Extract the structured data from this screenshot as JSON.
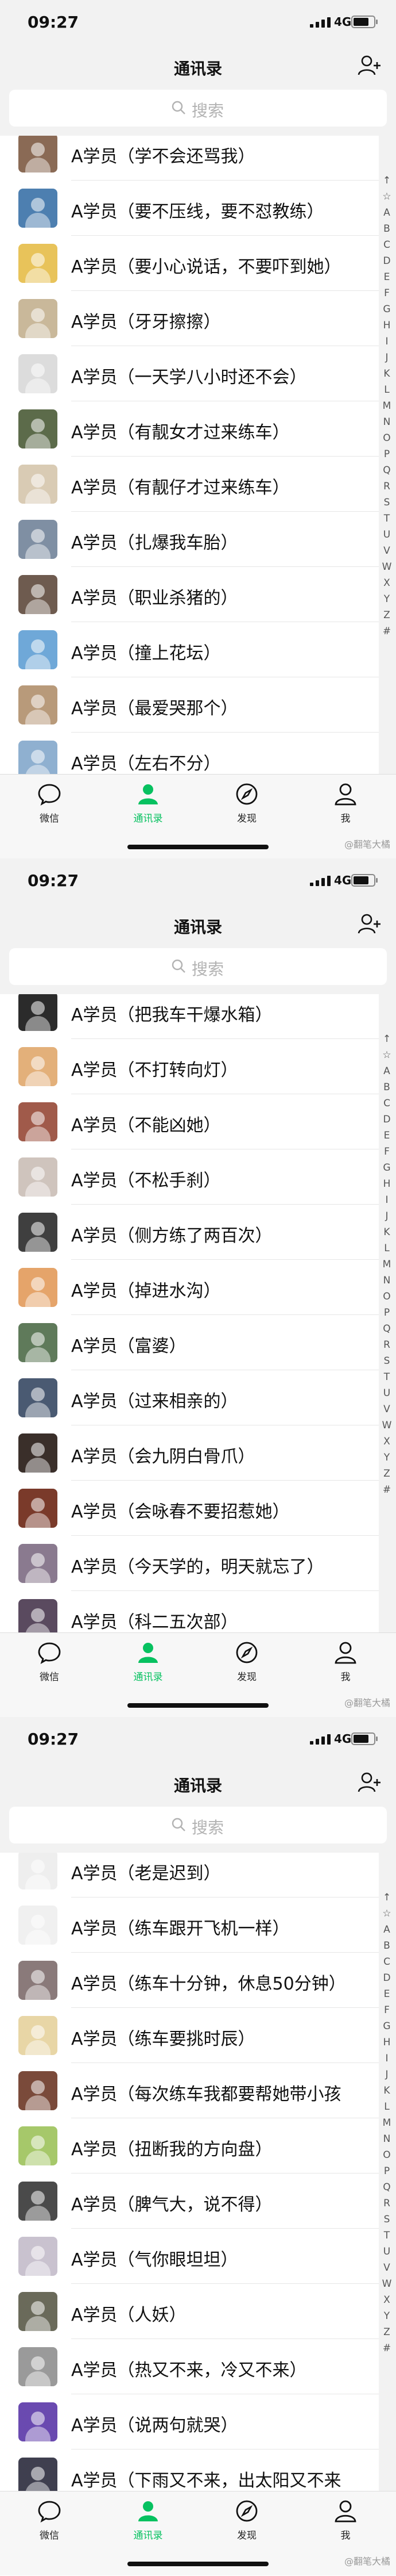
{
  "status": {
    "time": "09:27",
    "network": "4G"
  },
  "nav": {
    "title": "通讯录"
  },
  "search": {
    "placeholder": "搜索"
  },
  "index": [
    "↑",
    "☆",
    "A",
    "B",
    "C",
    "D",
    "E",
    "F",
    "G",
    "H",
    "I",
    "J",
    "K",
    "L",
    "M",
    "N",
    "O",
    "P",
    "Q",
    "R",
    "S",
    "T",
    "U",
    "V",
    "W",
    "X",
    "Y",
    "Z",
    "#"
  ],
  "tabs": [
    {
      "label": "微信",
      "icon": "chat-icon"
    },
    {
      "label": "通讯录",
      "icon": "contacts-icon",
      "active": true
    },
    {
      "label": "发现",
      "icon": "compass-icon"
    },
    {
      "label": "我",
      "icon": "profile-icon"
    }
  ],
  "watermark": "@翻笔大橘",
  "panels": [
    {
      "contacts": [
        {
          "name": "A学员（学不会还骂我）",
          "color": "#8a6a55"
        },
        {
          "name": "A学员（要不压线，要不怼教练）",
          "color": "#4d7fb0"
        },
        {
          "name": "A学员（要小心说话，不要吓到她）",
          "color": "#e8c35a"
        },
        {
          "name": "A学员（牙牙擦擦）",
          "color": "#c9b89a"
        },
        {
          "name": "A学员（一天学八小时还不会）",
          "color": "#dcdcdc",
          "plain": true
        },
        {
          "name": "A学员（有靓女才过来练车）",
          "color": "#5c6b4a"
        },
        {
          "name": "A学员（有靓仔才过来练车）",
          "color": "#d9cbb4"
        },
        {
          "name": "A学员（扎爆我车胎）",
          "color": "#7f8fa3"
        },
        {
          "name": "A学员（职业杀猪的）",
          "color": "#6e5b4f"
        },
        {
          "name": "A学员（撞上花坛）",
          "color": "#6fa8d8"
        },
        {
          "name": "A学员（最爱哭那个）",
          "color": "#b89a7a"
        },
        {
          "name": "A学员（左右不分）",
          "color": "#8fb0d0"
        }
      ]
    },
    {
      "contacts": [
        {
          "name": "A学员（把我车干爆水箱）",
          "color": "#2b2b2b"
        },
        {
          "name": "A学员（不打转向灯）",
          "color": "#e3b07a"
        },
        {
          "name": "A学员（不能凶她）",
          "color": "#a05a4a"
        },
        {
          "name": "A学员（不松手刹）",
          "color": "#cfc4bd"
        },
        {
          "name": "A学员（侧方练了两百次）",
          "color": "#3f3f3f"
        },
        {
          "name": "A学员（掉进水沟）",
          "color": "#e5a46a"
        },
        {
          "name": "A学员（富婆）",
          "color": "#5f7a5a"
        },
        {
          "name": "A学员（过来相亲的）",
          "color": "#4a5a72"
        },
        {
          "name": "A学员（会九阴白骨爪）",
          "color": "#3a2f2a"
        },
        {
          "name": "A学员（会咏春不要招惹她）",
          "color": "#7a3a2a"
        },
        {
          "name": "A学员（今天学的，明天就忘了）",
          "color": "#8a7a8f"
        },
        {
          "name": "A学员（科二五次部）",
          "color": "#5a4a5f"
        }
      ]
    },
    {
      "contacts": [
        {
          "name": "A学员（老是迟到）",
          "color": "#eeeeee"
        },
        {
          "name": "A学员（练车跟开飞机一样）",
          "color": "#f0f0f0"
        },
        {
          "name": "A学员（练车十分钟，休息50分钟）",
          "color": "#8a7a7a"
        },
        {
          "name": "A学员（练车要挑时辰）",
          "color": "#e8d6a6"
        },
        {
          "name": "A学员（每次练车我都要帮她带小孩",
          "color": "#7a4a3a"
        },
        {
          "name": "A学员（扭断我的方向盘）",
          "color": "#a6c86a"
        },
        {
          "name": "A学员（脾气大，说不得）",
          "color": "#4a4a4a"
        },
        {
          "name": "A学员（气你眼坦坦）",
          "color": "#c9c2cf"
        },
        {
          "name": "A学员（人妖）",
          "color": "#6a6a5a"
        },
        {
          "name": "A学员（热又不来，冷又不来）",
          "color": "#9a9a9a"
        },
        {
          "name": "A学员（说两句就哭）",
          "color": "#6a4ab0"
        },
        {
          "name": "A学员（下雨又不来，出太阳又不来",
          "color": "#3f3f4f"
        }
      ]
    }
  ]
}
